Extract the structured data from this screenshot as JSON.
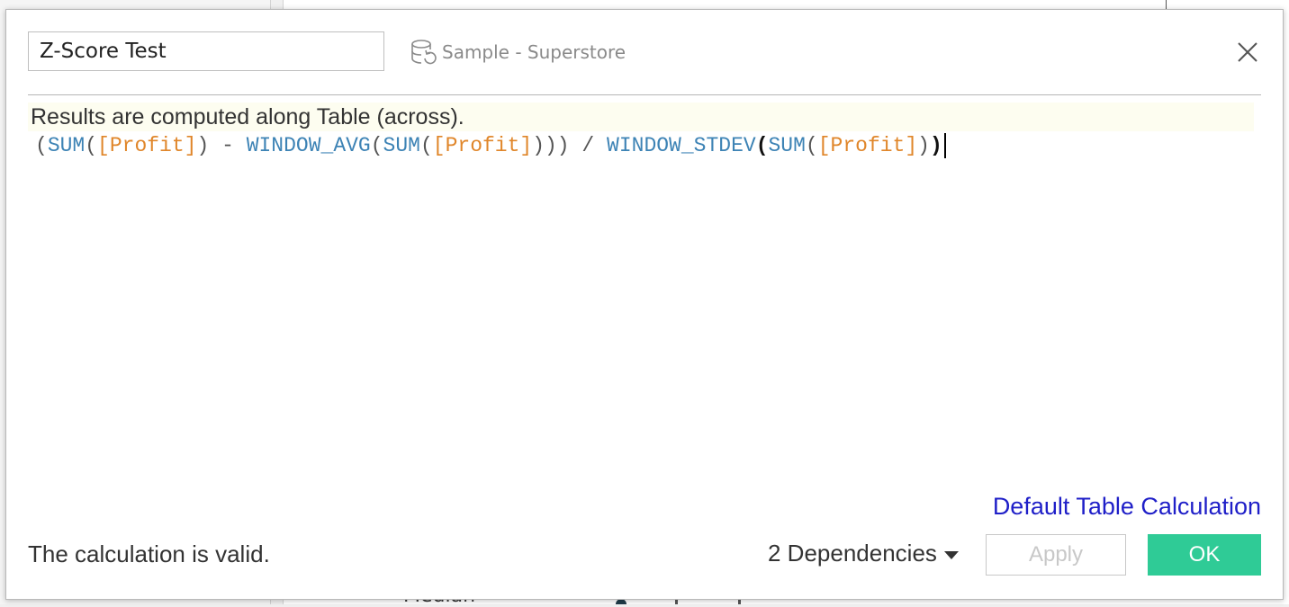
{
  "background": {
    "peek_text": "Median"
  },
  "dialog": {
    "calc_name": "Z-Score Test",
    "data_source": {
      "icon": "database-icon",
      "label": "Sample - Superstore"
    },
    "close_icon": "close-icon",
    "hint": "Results are computed along Table (across).",
    "formula_tokens": [
      {
        "text": "(",
        "kind": "punct"
      },
      {
        "text": "SUM",
        "kind": "func"
      },
      {
        "text": "(",
        "kind": "punct"
      },
      {
        "text": "[Profit]",
        "kind": "field"
      },
      {
        "text": ")",
        "kind": "punct"
      },
      {
        "text": " - ",
        "kind": "op"
      },
      {
        "text": "WINDOW_AVG",
        "kind": "func"
      },
      {
        "text": "(",
        "kind": "punct"
      },
      {
        "text": "SUM",
        "kind": "func"
      },
      {
        "text": "(",
        "kind": "punct"
      },
      {
        "text": "[Profit]",
        "kind": "field"
      },
      {
        "text": ")))",
        "kind": "punct"
      },
      {
        "text": " / ",
        "kind": "op"
      },
      {
        "text": "WINDOW_STDEV",
        "kind": "func"
      },
      {
        "text": "(",
        "kind": "bold"
      },
      {
        "text": "SUM",
        "kind": "func"
      },
      {
        "text": "(",
        "kind": "punct"
      },
      {
        "text": "[Profit]",
        "kind": "field"
      },
      {
        "text": ")",
        "kind": "punct"
      },
      {
        "text": ")",
        "kind": "bold"
      }
    ],
    "default_table_calc_link": "Default Table Calculation",
    "status_text": "The calculation is valid.",
    "dependencies_label": "2 Dependencies",
    "apply_label": "Apply",
    "ok_label": "OK",
    "colors": {
      "function": "#3d83b5",
      "field": "#e0862a",
      "link": "#1f1fc8",
      "ok_button": "#2fcb96",
      "hint_background": "#fdfdf0"
    }
  }
}
